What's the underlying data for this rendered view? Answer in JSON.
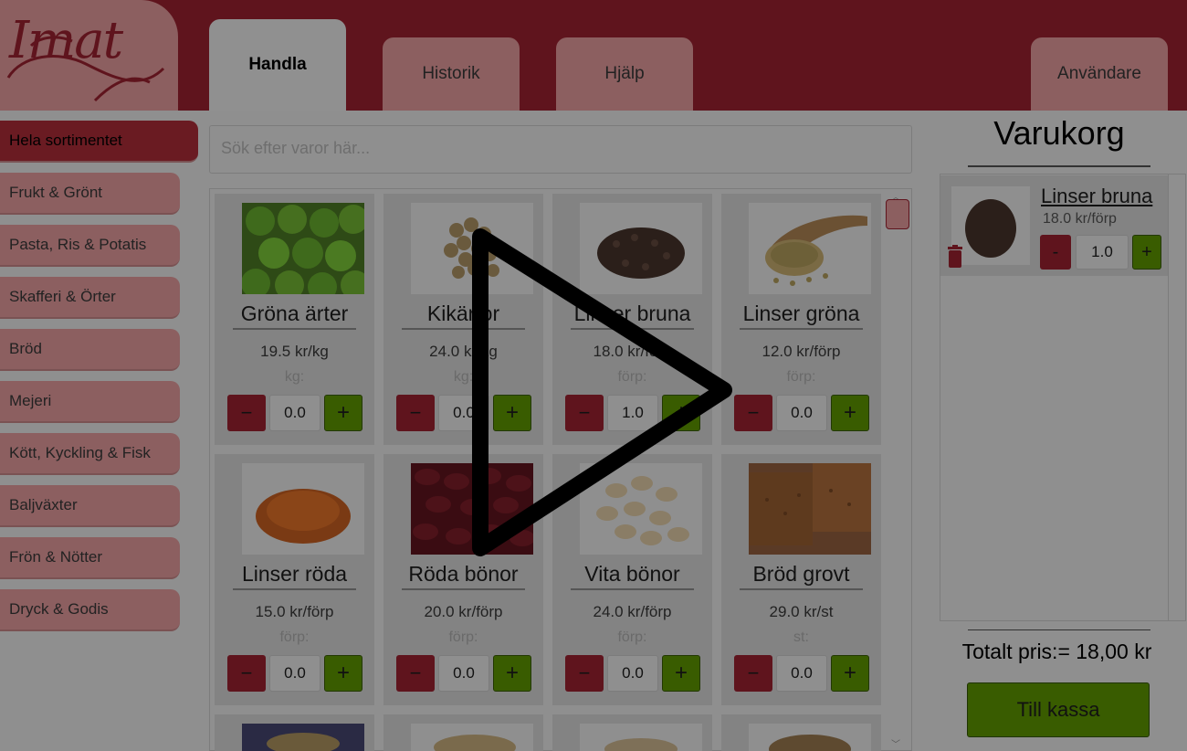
{
  "header": {
    "logo_text": "Imat",
    "tabs": [
      {
        "label": "Handla",
        "active": true
      },
      {
        "label": "Historik",
        "active": false
      },
      {
        "label": "Hjälp",
        "active": false
      },
      {
        "label": "Användare",
        "active": false
      }
    ]
  },
  "sidebar": {
    "items": [
      {
        "label": "Hela sortimentet",
        "active": true
      },
      {
        "label": "Frukt & Grönt"
      },
      {
        "label": "Pasta, Ris & Potatis"
      },
      {
        "label": "Skafferi & Örter"
      },
      {
        "label": "Bröd"
      },
      {
        "label": "Mejeri"
      },
      {
        "label": "Kött, Kyckling & Fisk"
      },
      {
        "label": "Baljväxter"
      },
      {
        "label": "Frön & Nötter"
      },
      {
        "label": "Dryck & Godis"
      }
    ]
  },
  "search": {
    "placeholder": "Sök efter varor här..."
  },
  "products": [
    {
      "name": "Gröna ärter",
      "price": "19.5 kr/kg",
      "unit": "kg:",
      "qty": "0.0",
      "icon": "green-peas-icon"
    },
    {
      "name": "Kikärtor",
      "price": "24.0 kr/kg",
      "unit": "kg:",
      "qty": "0.0",
      "icon": "chickpeas-icon"
    },
    {
      "name": "Linser bruna",
      "price": "18.0 kr/förp",
      "unit": "förp:",
      "qty": "1.0",
      "icon": "brown-lentils-icon"
    },
    {
      "name": "Linser gröna",
      "price": "12.0 kr/förp",
      "unit": "förp:",
      "qty": "0.0",
      "icon": "green-lentils-icon"
    },
    {
      "name": "Linser röda",
      "price": "15.0 kr/förp",
      "unit": "förp:",
      "qty": "0.0",
      "icon": "red-lentils-icon"
    },
    {
      "name": "Röda bönor",
      "price": "20.0 kr/förp",
      "unit": "förp:",
      "qty": "0.0",
      "icon": "kidney-beans-icon"
    },
    {
      "name": "Vita bönor",
      "price": "24.0 kr/förp",
      "unit": "förp:",
      "qty": "0.0",
      "icon": "white-beans-icon"
    },
    {
      "name": "Bröd grovt",
      "price": "29.0 kr/st",
      "unit": "st:",
      "qty": "0.0",
      "icon": "bread-icon"
    }
  ],
  "cart": {
    "title": "Varukorg",
    "item": {
      "name": "Linser bruna",
      "price": "18.0 kr/förp",
      "qty": "1.0"
    },
    "total": "Totalt pris:= 18,00 kr",
    "checkout_label": "Till kassa"
  },
  "colors": {
    "header_bg": "#5f141d",
    "tab_bg": "#8c5f60",
    "minus_btn": "#5f141d",
    "plus_btn": "#395c00"
  }
}
